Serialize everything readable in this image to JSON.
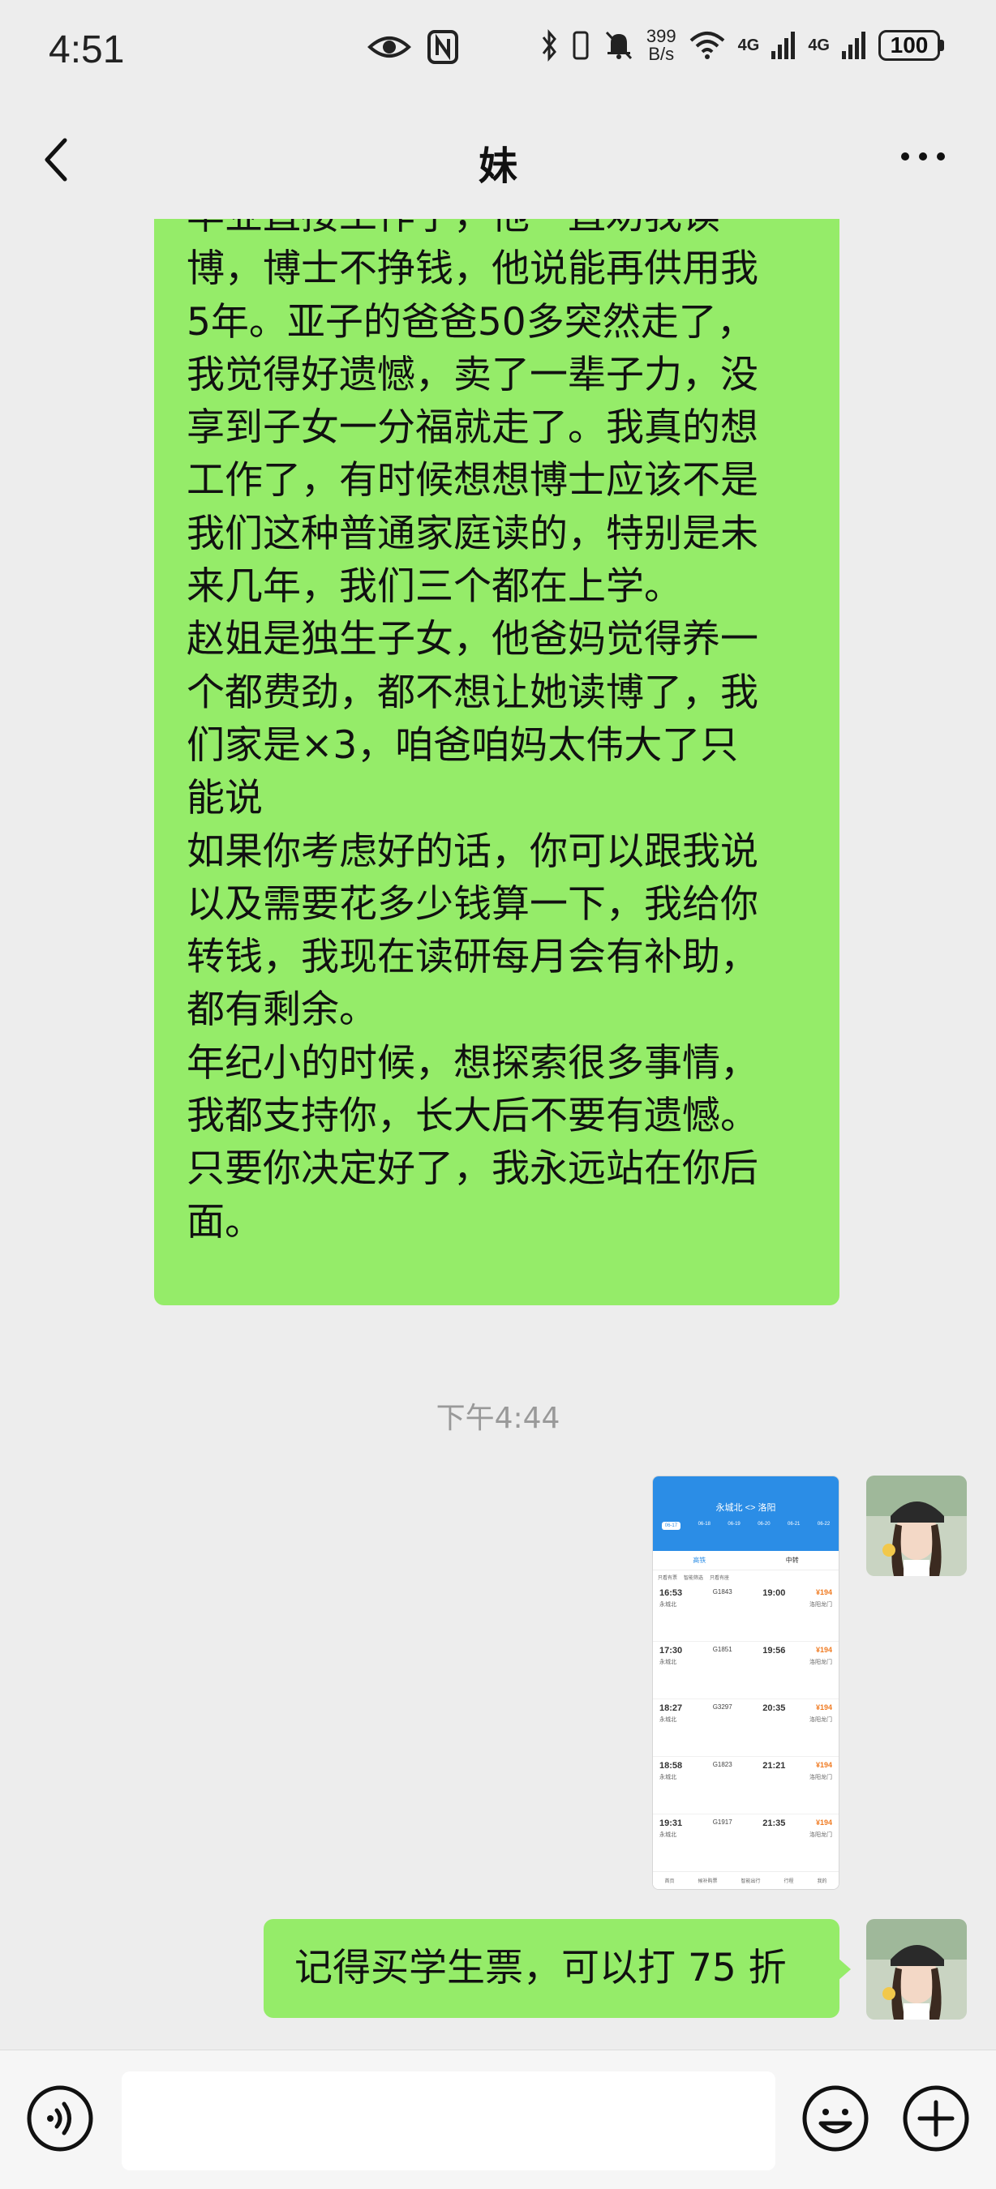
{
  "status_bar": {
    "time": "4:51",
    "net_speed_value": "399",
    "net_speed_unit": "B/s",
    "signal1": "4G",
    "signal2": "4G",
    "battery": "100"
  },
  "header": {
    "title": "妹"
  },
  "messages": {
    "long_text": "毕业直接工作了，他一直劝我读\n博，博士不挣钱，他说能再供用我\n5年。亚子的爸爸50多突然走了，\n我觉得好遗憾，卖了一辈子力，没\n享到子女一分福就走了。我真的想\n工作了，有时候想想博士应该不是\n我们这种普通家庭读的，特别是未\n来几年，我们三个都在上学。\n赵姐是独生子女，他爸妈觉得养一\n个都费劲，都不想让她读博了，我\n们家是×3，咱爸咱妈太伟大了只\n能说\n如果你考虑好的话，你可以跟我说\n以及需要花多少钱算一下，我给你\n转钱，我现在读研每月会有补助，\n都有剩余。\n年纪小的时候，想探索很多事情，\n我都支持你，长大后不要有遗憾。\n只要你决定好了，我永远站在你后\n面。",
    "timestamp": "下午4:44",
    "short_text": "记得买学生票，可以打 75 折"
  },
  "screenshot": {
    "route": "永城北 <> 洛阳",
    "dates": [
      "06-17",
      "06-18",
      "06-19",
      "06-20",
      "06-21",
      "06-22"
    ],
    "tabs": [
      "高铁",
      "中转"
    ],
    "filters": [
      "只看有票",
      "智能筛选",
      "只看有座"
    ],
    "trains": [
      {
        "dep": "16:53",
        "no": "G1843",
        "arr": "19:00",
        "from": "永城北",
        "to": "洛阳龙门",
        "price": "¥194"
      },
      {
        "dep": "17:30",
        "no": "G1851",
        "arr": "19:56",
        "from": "永城北",
        "to": "洛阳龙门",
        "price": "¥194"
      },
      {
        "dep": "18:27",
        "no": "G3297",
        "arr": "20:35",
        "from": "永城北",
        "to": "洛阳龙门",
        "price": "¥194"
      },
      {
        "dep": "18:58",
        "no": "G1823",
        "arr": "21:21",
        "from": "永城北",
        "to": "洛阳龙门",
        "price": "¥194"
      },
      {
        "dep": "19:31",
        "no": "G1917",
        "arr": "21:35",
        "from": "永城北",
        "to": "洛阳龙门",
        "price": "¥194"
      }
    ],
    "bottom_nav": [
      "首页",
      "候补购票",
      "智能出行",
      "行程",
      "我的"
    ]
  },
  "colors": {
    "bubble_green": "#95ec69",
    "background": "#ededed",
    "accent_blue": "#2b8de6"
  },
  "icons": [
    "eye-icon",
    "nfc-icon",
    "bluetooth-icon",
    "vibrate-icon",
    "mute-bell-icon",
    "wifi-icon",
    "signal-icon",
    "battery-icon",
    "back-icon",
    "more-icon",
    "voice-icon",
    "emoji-icon",
    "plus-icon"
  ]
}
